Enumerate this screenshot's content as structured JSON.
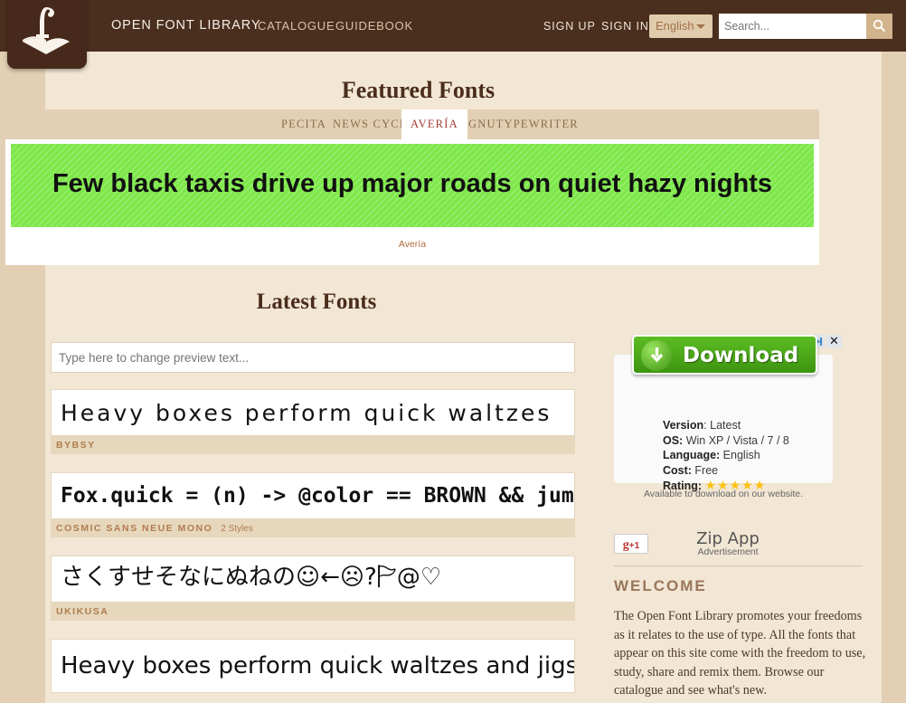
{
  "header": {
    "logo_icon": "open-book-f-logo",
    "brand": "OPEN FONT LIBRARY",
    "nav": [
      {
        "label": "CATALOGUE"
      },
      {
        "label": "GUIDEBOOK"
      }
    ],
    "auth": {
      "sign_up": "SIGN UP",
      "sign_in": "SIGN IN"
    },
    "language": {
      "selected": "English",
      "caret_icon": "chevron-down-icon"
    },
    "search": {
      "value": "",
      "placeholder": "Search...",
      "button_icon": "search-icon"
    },
    "colors": {
      "bar": "#4a2e1e",
      "logo_box": "#46291a"
    }
  },
  "featured": {
    "title": "Featured Fonts",
    "tabs": [
      {
        "label": "PECITA",
        "active": false
      },
      {
        "label": "NEWS CYCLE",
        "active": false
      },
      {
        "label": "AVERÍA",
        "active": true
      },
      {
        "label": "GNUTYPEWRITER",
        "active": false
      }
    ],
    "banner_text": "Few black taxis drive up major roads on quiet hazy nights",
    "caption": "Avería",
    "banner_color": "#7ee84a"
  },
  "latest": {
    "title": "Latest Fonts",
    "preview_input": {
      "value": "",
      "placeholder": "Type here to change preview text..."
    },
    "fonts": [
      {
        "sample": "Heavy boxes perform quick waltzes",
        "name": "BYBSY",
        "styles": ""
      },
      {
        "sample": "Fox.quick = (n) -> @color == BROWN && jum",
        "name": "COSMIC SANS NEUE MONO",
        "styles": "2 Styles"
      },
      {
        "sample": "さくすせそなにぬねの☺←☹?🏱@♡",
        "name": "UKIKUSA",
        "styles": ""
      },
      {
        "sample": "Heavy boxes perform quick waltzes and jigs",
        "name": "",
        "styles": ""
      }
    ]
  },
  "sidebar": {
    "ad": {
      "adchoices_icon": "adchoices-icon",
      "close_icon": "close-icon",
      "download_icon": "download-arrow-icon",
      "download_label": "Download",
      "specs": [
        {
          "label": "Version",
          "value": ": Latest"
        },
        {
          "label": "OS:",
          "value": " Win XP / Vista / 7 / 8"
        },
        {
          "label": "Language:",
          "value": " English"
        },
        {
          "label": "Cost:",
          "value": " Free"
        }
      ],
      "rating_label": "Rating:",
      "rating_stars": "★★★★★",
      "footer": "Available to download on our website."
    },
    "gplus": {
      "g": "g",
      "plus_one": "+1"
    },
    "zip_app": {
      "title": "Zip App",
      "subtitle": "Advertisement"
    },
    "welcome": {
      "heading": "WELCOME",
      "body": "The Open Font Library promotes your freedoms as it relates to the use of type. All the fonts that appear on this site come with the freedom to use, study, share and remix them. Browse our catalogue and see what's new."
    }
  }
}
